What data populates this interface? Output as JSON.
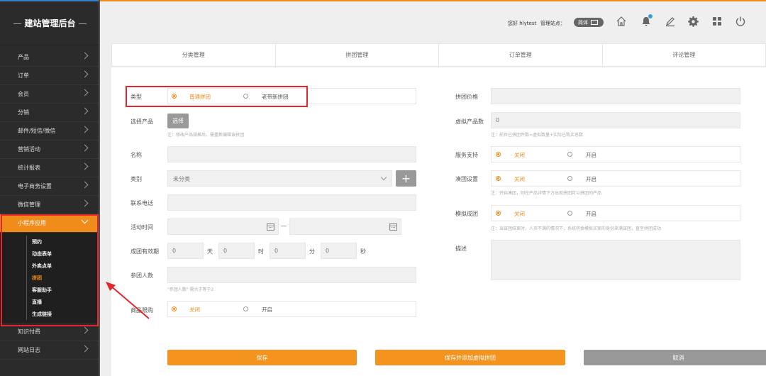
{
  "brand": {
    "title": "建站管理后台"
  },
  "sidebar": {
    "items": [
      {
        "label": "产品"
      },
      {
        "label": "订单"
      },
      {
        "label": "会员"
      },
      {
        "label": "分销"
      },
      {
        "label": "邮件/短信/微信"
      },
      {
        "label": "营销活动"
      },
      {
        "label": "统计报表"
      },
      {
        "label": "电子商务设置"
      },
      {
        "label": "微信管理"
      }
    ],
    "active": {
      "label": "小程序应用"
    },
    "sub_items": [
      {
        "label": "预约"
      },
      {
        "label": "动态表单"
      },
      {
        "label": "外卖点单"
      },
      {
        "label": "拼团",
        "current": true
      },
      {
        "label": "客服助手"
      },
      {
        "label": "直播"
      },
      {
        "label": "生成链接"
      }
    ],
    "bottom_items": [
      {
        "label": "知识付费"
      },
      {
        "label": "网站日志"
      }
    ]
  },
  "header": {
    "greeting": "您好 hlytest",
    "site_label": "管理站点：",
    "lang": "简体",
    "icons": [
      "home-icon",
      "bell-icon",
      "edit-icon",
      "gear-icon",
      "grid-icon",
      "power-icon"
    ]
  },
  "tabs": [
    {
      "label": "分类管理"
    },
    {
      "label": "拼团管理"
    },
    {
      "label": "订单管理"
    },
    {
      "label": "评论管理"
    }
  ],
  "form": {
    "type_label": "类型",
    "type_opt1": "普通拼团",
    "type_opt2": "老带新拼团",
    "product_label": "选择产品",
    "product_btn": "选择",
    "product_note": "注：修改产品规格后，需重新编辑该拼团",
    "name_label": "名称",
    "category_label": "类别",
    "category_value": "未分类",
    "phone_label": "联系电话",
    "time_label": "活动时间",
    "time_dash": "—",
    "valid_label": "成团有效期",
    "valid_day": "0",
    "valid_day_unit": "天",
    "valid_hour": "0",
    "valid_hour_unit": "时",
    "valid_min": "0",
    "valid_min_unit": "分",
    "valid_sec": "0",
    "valid_sec_unit": "秒",
    "people_label": "参团人数",
    "people_note": "\"参团人数\" 需大于等于2",
    "limit_label": "商品限购",
    "limit_opt1": "关闭",
    "limit_opt2": "开启",
    "price_label": "拼团价格",
    "virtual_label": "虚拟产品数",
    "virtual_value": "0",
    "virtual_note": "注：前台已拼团件数=虚拟数量+实际已购买总数",
    "service_label": "服务支持",
    "service_opt1": "关闭",
    "service_opt2": "开启",
    "gather_label": "凑团设置",
    "gather_opt1": "关闭",
    "gather_opt2": "开启",
    "gather_note": "注：开启凑团，则在产品详情下方出现拼团可以拼团的产品",
    "simulate_label": "模拟成团",
    "simulate_opt1": "关闭",
    "simulate_opt2": "开启",
    "simulate_note": "注：当该团结束时，人员不满的情况下，系统将会模拟买家的身份来满该团，直至拼团成功",
    "desc_label": "描述"
  },
  "actions": {
    "save": "保存",
    "save_add": "保存并添加虚拟拼团",
    "cancel": "取消"
  },
  "colors": {
    "accent": "#f08c1a",
    "highlight": "#e4262c",
    "sidebar": "#2b2b2b"
  }
}
